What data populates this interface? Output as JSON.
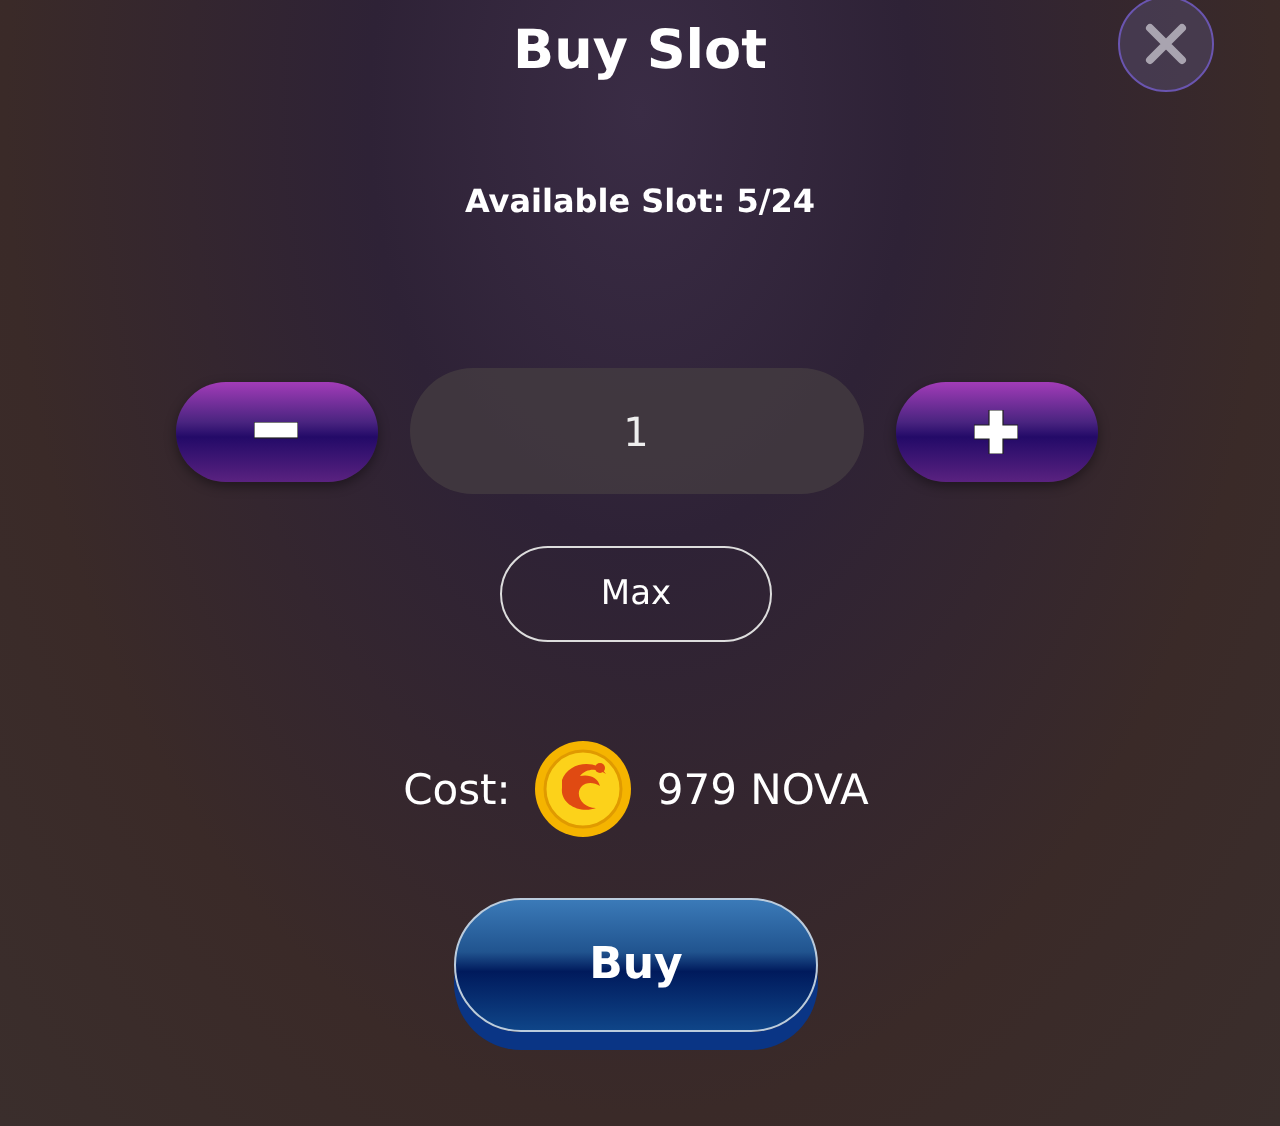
{
  "dialog": {
    "title": "Buy Slot",
    "available": "Available Slot: 5/24"
  },
  "quantity": {
    "value": "1"
  },
  "max_button": "Max",
  "cost": {
    "label": "Cost:",
    "amount": "979 NOVA"
  },
  "buy_button": "Buy"
}
